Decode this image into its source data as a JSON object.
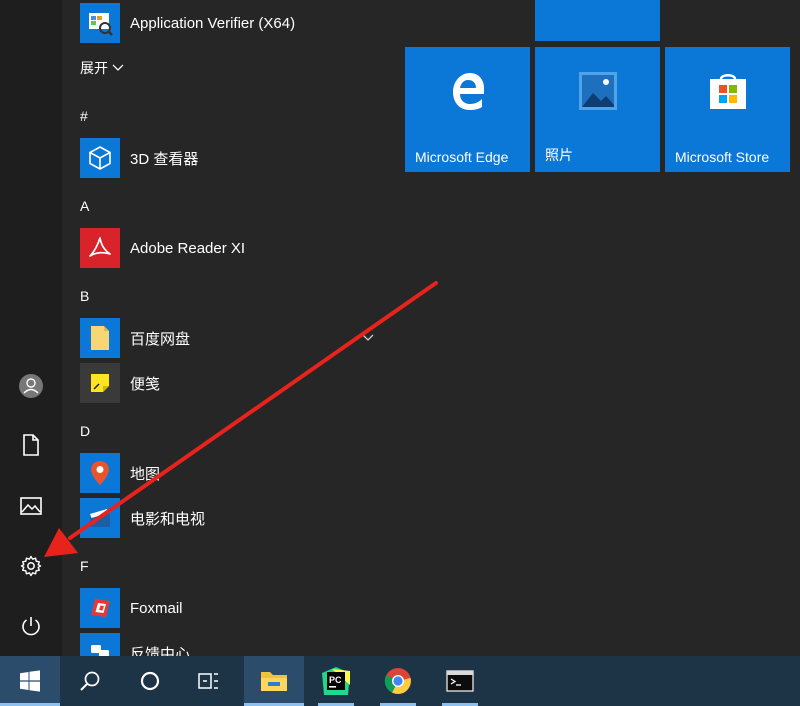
{
  "app_list": {
    "expand_label": "展开",
    "groups": {
      "hash": "#",
      "a": "A",
      "b": "B",
      "d": "D",
      "f": "F"
    },
    "items": {
      "app_verifier": "Application Verifier (X64)",
      "viewer_3d": "3D 查看器",
      "adobe_reader": "Adobe Reader XI",
      "baidu_netdisk": "百度网盘",
      "sticky_notes": "便笺",
      "maps": "地图",
      "movies_tv": "电影和电视",
      "foxmail": "Foxmail",
      "feedback_hub": "反馈中心"
    }
  },
  "tiles": {
    "edge": "Microsoft Edge",
    "photos": "照片",
    "store": "Microsoft Store"
  },
  "icons": {
    "rail": [
      "user-avatar-icon",
      "document-icon",
      "pictures-icon",
      "settings-gear-icon",
      "power-icon"
    ],
    "taskbar": [
      "windows-logo-icon",
      "search-icon",
      "cortana-icon",
      "task-view-icon",
      "file-explorer-icon",
      "pycharm-icon",
      "chrome-icon",
      "terminal-icon"
    ]
  },
  "colors": {
    "accent": "#0b78d7",
    "annotation_arrow": "#e8231c",
    "taskbar": "#1d3346"
  }
}
